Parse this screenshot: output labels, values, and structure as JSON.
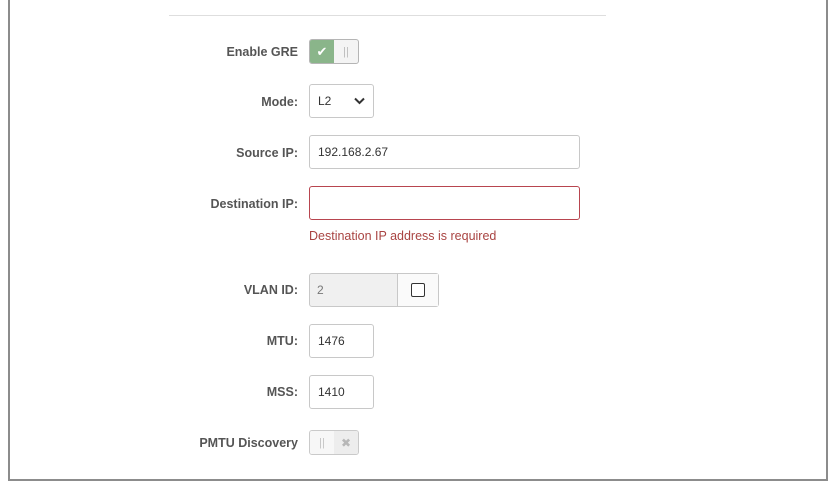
{
  "form": {
    "enable_gre": {
      "label": "Enable GRE",
      "on": true
    },
    "mode": {
      "label": "Mode:",
      "value": "L2",
      "icon": "chevron-down-icon"
    },
    "source_ip": {
      "label": "Source IP:",
      "value": "192.168.2.67"
    },
    "destination_ip": {
      "label": "Destination IP:",
      "value": "",
      "error": "Destination IP address is required",
      "error_color": "#a94442"
    },
    "vlan_id": {
      "label": "VLAN ID:",
      "value": "2",
      "checked": false
    },
    "mtu": {
      "label": "MTU:",
      "value": "1476"
    },
    "mss": {
      "label": "MSS:",
      "value": "1410"
    },
    "pmtu_discovery": {
      "label": "PMTU Discovery",
      "on": false
    }
  },
  "colors": {
    "toggle_on": "#8ab58a",
    "error_border": "#b8454f"
  }
}
